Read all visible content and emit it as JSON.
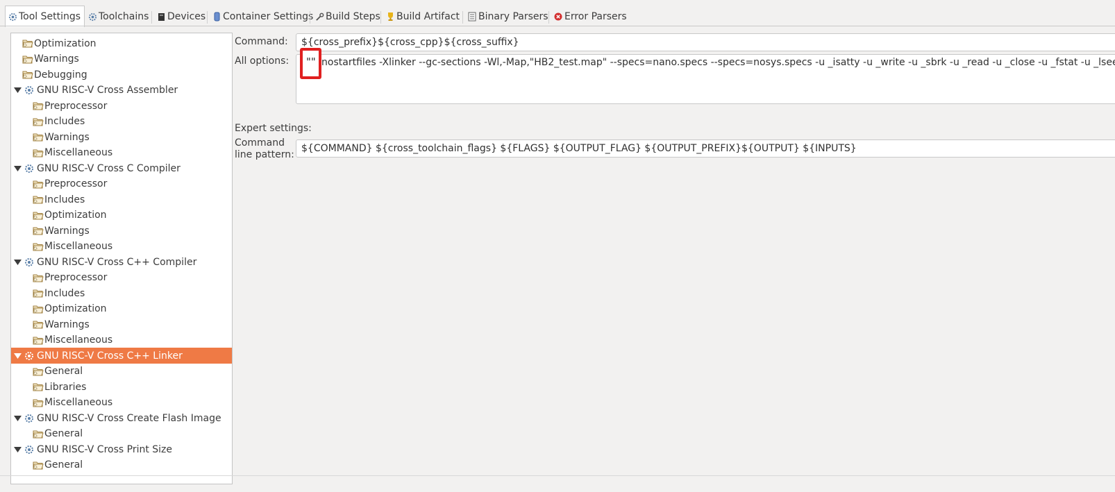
{
  "tabs": [
    {
      "label": "Tool Settings",
      "icon": "gear-icon"
    },
    {
      "label": "Toolchains",
      "icon": "gear-icon"
    },
    {
      "label": "Devices",
      "icon": "chip-icon"
    },
    {
      "label": "Container Settings",
      "icon": "container-icon"
    },
    {
      "label": "Build Steps",
      "icon": "wrench-icon"
    },
    {
      "label": "Build Artifact",
      "icon": "trophy-icon"
    },
    {
      "label": "Binary Parsers",
      "icon": "binary-icon"
    },
    {
      "label": "Error Parsers",
      "icon": "error-icon"
    }
  ],
  "tree": {
    "items": [
      {
        "label": "Optimization",
        "level": 1
      },
      {
        "label": "Warnings",
        "level": 1
      },
      {
        "label": "Debugging",
        "level": 1
      },
      {
        "label": "GNU RISC-V Cross Assembler",
        "level": 0
      },
      {
        "label": "Preprocessor",
        "level": 2
      },
      {
        "label": "Includes",
        "level": 2
      },
      {
        "label": "Warnings",
        "level": 2
      },
      {
        "label": "Miscellaneous",
        "level": 2
      },
      {
        "label": "GNU RISC-V Cross C Compiler",
        "level": 0
      },
      {
        "label": "Preprocessor",
        "level": 2
      },
      {
        "label": "Includes",
        "level": 2
      },
      {
        "label": "Optimization",
        "level": 2
      },
      {
        "label": "Warnings",
        "level": 2
      },
      {
        "label": "Miscellaneous",
        "level": 2
      },
      {
        "label": "GNU RISC-V Cross C++ Compiler",
        "level": 0
      },
      {
        "label": "Preprocessor",
        "level": 2
      },
      {
        "label": "Includes",
        "level": 2
      },
      {
        "label": "Optimization",
        "level": 2
      },
      {
        "label": "Warnings",
        "level": 2
      },
      {
        "label": "Miscellaneous",
        "level": 2
      },
      {
        "label": "GNU RISC-V Cross C++ Linker",
        "level": 0,
        "selected": true
      },
      {
        "label": "General",
        "level": 2
      },
      {
        "label": "Libraries",
        "level": 2
      },
      {
        "label": "Miscellaneous",
        "level": 2
      },
      {
        "label": "GNU RISC-V Cross Create Flash Image",
        "level": 0
      },
      {
        "label": "General",
        "level": 2
      },
      {
        "label": "GNU RISC-V Cross Print Size",
        "level": 0
      },
      {
        "label": "General",
        "level": 2
      }
    ]
  },
  "settings": {
    "command_label": "Command:",
    "command_value": "${cross_prefix}${cross_cpp}${cross_suffix}",
    "all_options_label": "All options:",
    "all_options_value": "-nostartfiles -Xlinker --gc-sections -Wl,-Map,\"HB2_test.map\" --specs=nano.specs --specs=nosys.specs -u _isatty -u _write -u _sbrk -u _read -u _close -u _fstat -u _lseek",
    "highlight_text": "\"\"",
    "expert_label": "Expert settings:",
    "pattern_label_line1": "Command",
    "pattern_label_line2": "line pattern:",
    "pattern_value": "${COMMAND} ${cross_toolchain_flags} ${FLAGS} ${OUTPUT_FLAG} ${OUTPUT_PREFIX}${OUTPUT} ${INPUTS}"
  },
  "colors": {
    "selection": "#ef7a45",
    "highlight_box": "#e02020"
  }
}
